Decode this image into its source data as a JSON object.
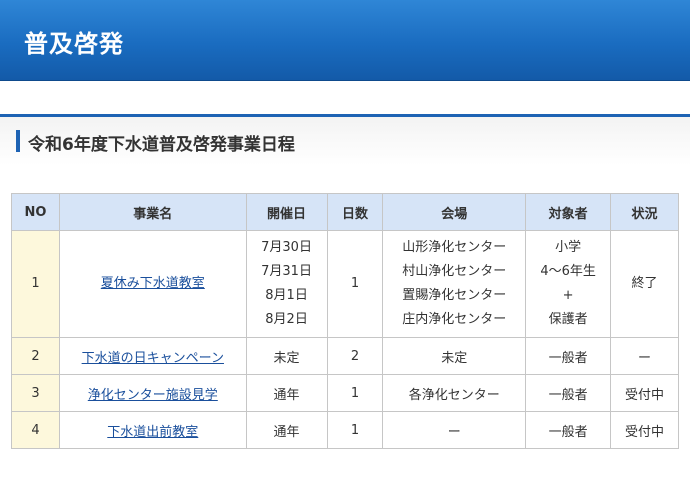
{
  "banner": {
    "title": "普及啓発"
  },
  "section": {
    "title": "令和6年度下水道普及啓発事業日程"
  },
  "table": {
    "headers": [
      "NO",
      "事業名",
      "開催日",
      "日数",
      "会場",
      "対象者",
      "状況"
    ],
    "rows": [
      {
        "no": "1",
        "name": "夏休み下水道教室",
        "dates": [
          "7月30日",
          "7月31日",
          "8月1日",
          "8月2日"
        ],
        "days": "1",
        "venues": [
          "山形浄化センター",
          "村山浄化センター",
          "置賜浄化センター",
          "庄内浄化センター"
        ],
        "target": [
          "小学",
          "4〜6年生",
          "+",
          "保護者"
        ],
        "status": "終了"
      },
      {
        "no": "2",
        "name": "下水道の日キャンペーン",
        "date": "未定",
        "days": "2",
        "venue": "未定",
        "target": "一般者",
        "status": "ー"
      },
      {
        "no": "3",
        "name": "浄化センター施設見学",
        "date": "通年",
        "days": "1",
        "venue": "各浄化センター",
        "target": "一般者",
        "status": "受付中"
      },
      {
        "no": "4",
        "name": "下水道出前教室",
        "date": "通年",
        "days": "1",
        "venue": "ー",
        "target": "一般者",
        "status": "受付中"
      }
    ]
  }
}
